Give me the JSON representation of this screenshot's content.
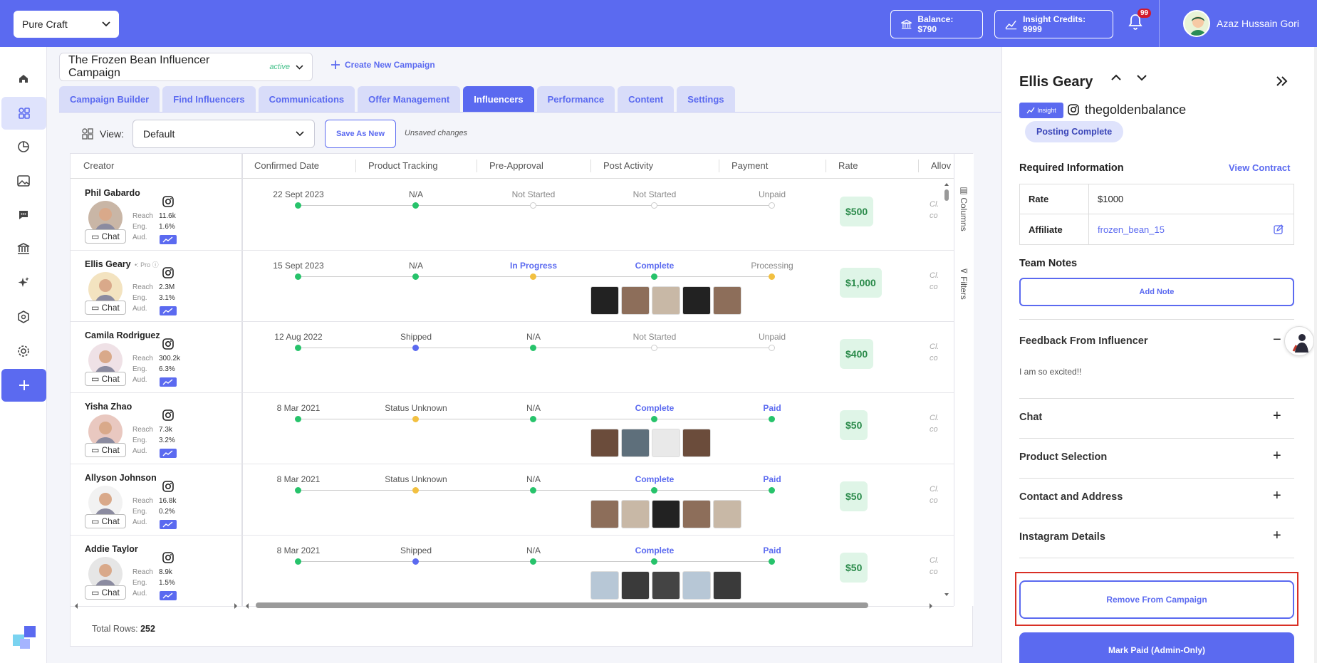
{
  "topbar": {
    "brand": "Pure Craft",
    "balance": "Balance: $790",
    "insight_credits": "Insight Credits: 9999",
    "notifications": "99",
    "user_name": "Azaz Hussain Gori"
  },
  "campaign": {
    "title": "The Frozen Bean Influencer Campaign",
    "status": "active",
    "create_new": "Create New Campaign"
  },
  "tabs": [
    "Campaign Builder",
    "Find Influencers",
    "Communications",
    "Offer Management",
    "Influencers",
    "Performance",
    "Content",
    "Settings"
  ],
  "view": {
    "label": "View:",
    "selected": "Default",
    "save_as_new": "Save As New",
    "unsaved": "Unsaved changes"
  },
  "table": {
    "headers": {
      "creator": "Creator",
      "confirmed_date": "Confirmed Date",
      "product_tracking": "Product Tracking",
      "pre_approval": "Pre-Approval",
      "post_activity": "Post Activity",
      "payment": "Payment",
      "rate": "Rate",
      "allow": "Allov"
    },
    "stat_labels": {
      "reach": "Reach",
      "eng": "Eng.",
      "aud": "Aud."
    },
    "chat_label": "Chat",
    "pro_label": "Pro",
    "allow_text": [
      "Cl.",
      "co"
    ],
    "rows": [
      {
        "name": "Phil Gabardo",
        "reach": "11.6k",
        "eng": "1.6%",
        "date": "22 Sept 2023",
        "tracking": "N/A",
        "pre_approval": "Not Started",
        "post": "Not Started",
        "payment": "Unpaid",
        "rate": "$500"
      },
      {
        "name": "Ellis Geary",
        "reach": "2.3M",
        "eng": "3.1%",
        "date": "15 Sept 2023",
        "tracking": "N/A",
        "pre_approval": "In Progress",
        "post": "Complete",
        "payment": "Processing",
        "rate": "$1,000"
      },
      {
        "name": "Camila Rodriguez",
        "reach": "300.2k",
        "eng": "6.3%",
        "date": "12 Aug 2022",
        "tracking": "Shipped",
        "pre_approval": "N/A",
        "post": "Not Started",
        "payment": "Unpaid",
        "rate": "$400"
      },
      {
        "name": "Yisha Zhao",
        "reach": "7.3k",
        "eng": "3.2%",
        "date": "8 Mar 2021",
        "tracking": "Status Unknown",
        "pre_approval": "N/A",
        "post": "Complete",
        "payment": "Paid",
        "rate": "$50"
      },
      {
        "name": "Allyson Johnson",
        "reach": "16.8k",
        "eng": "0.2%",
        "date": "8 Mar 2021",
        "tracking": "Status Unknown",
        "pre_approval": "N/A",
        "post": "Complete",
        "payment": "Paid",
        "rate": "$50"
      },
      {
        "name": "Addie Taylor",
        "reach": "8.9k",
        "eng": "1.5%",
        "date": "8 Mar 2021",
        "tracking": "Shipped",
        "pre_approval": "N/A",
        "post": "Complete",
        "payment": "Paid",
        "rate": "$50"
      }
    ],
    "side_tabs": {
      "columns": "Columns",
      "filters": "Filters"
    },
    "total_rows_label": "Total Rows:",
    "total_rows": "252"
  },
  "panel": {
    "name": "Ellis Geary",
    "insight_badge": "Insight",
    "handle": "thegoldenbalance",
    "status": "Posting Complete",
    "required_info": "Required Information",
    "view_contract": "View Contract",
    "rate_label": "Rate",
    "rate_value": "$1000",
    "affiliate_label": "Affiliate",
    "affiliate_value": "frozen_bean_15",
    "team_notes": "Team Notes",
    "add_note": "Add Note",
    "feedback_title": "Feedback From Influencer",
    "feedback_text": "I am so excited!!",
    "sections": [
      "Chat",
      "Product Selection",
      "Contact and Address",
      "Instagram Details"
    ],
    "remove_button": "Remove From Campaign",
    "mark_paid_button": "Mark Paid (Admin-Only)"
  },
  "colors": {
    "accent": "#5b6af0",
    "success": "#27c36b",
    "warning": "#f2c041",
    "danger": "#d93025"
  }
}
